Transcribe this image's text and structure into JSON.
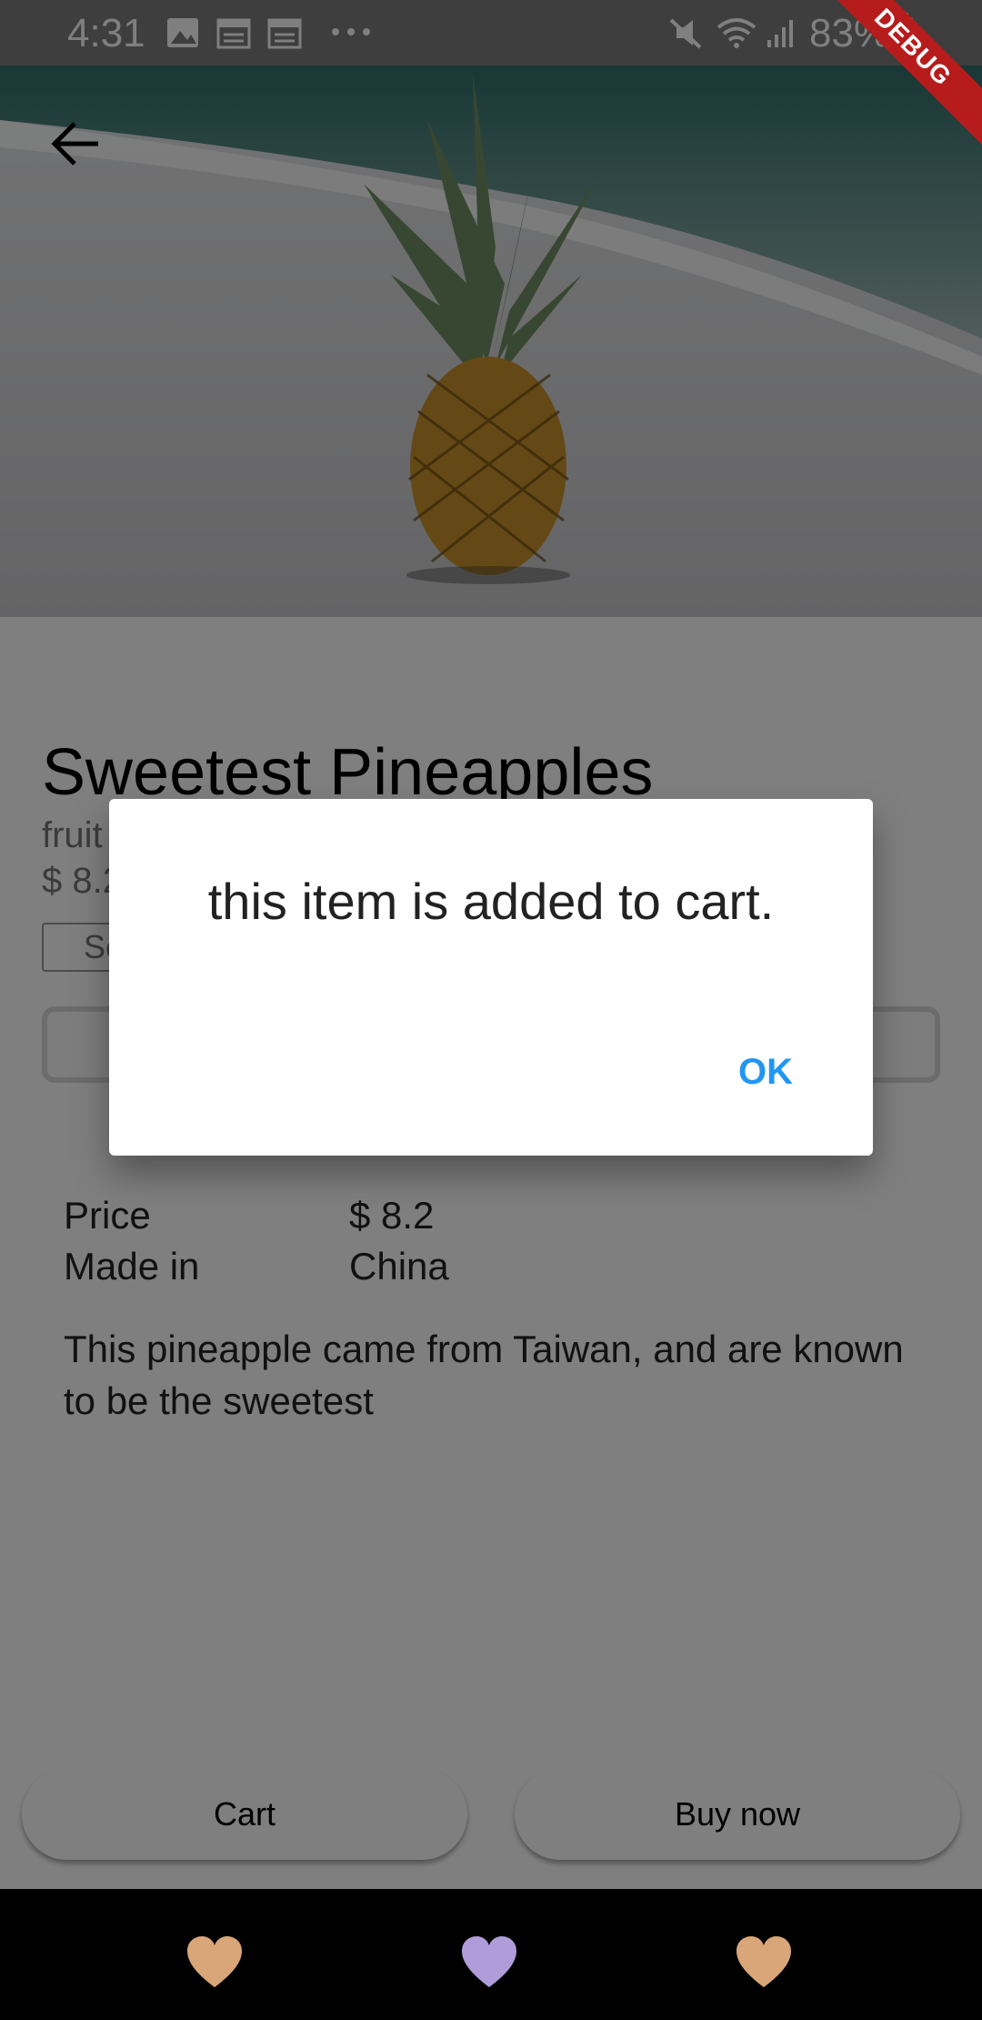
{
  "status_bar": {
    "time": "4:31",
    "battery": "83%",
    "icons": [
      "image-icon",
      "calendar-icon",
      "calendar-icon",
      "more-dots-icon",
      "mute-icon",
      "wifi-icon",
      "signal-icon",
      "battery-icon"
    ]
  },
  "debug_banner": "DEBUG",
  "product": {
    "title": "Sweetest Pineapples",
    "category": "fruit",
    "price_short": "$ 8.2",
    "select_label": "Se",
    "specs": [
      {
        "label": "Price",
        "value": "$ 8.2"
      },
      {
        "label": "Made in",
        "value": "China"
      }
    ],
    "description": "This pineapple came from Taiwan, and are known to be the sweetest"
  },
  "actions": {
    "cart_label": "Cart",
    "buy_label": "Buy now"
  },
  "dialog": {
    "message": "this item is added to cart.",
    "ok_label": "OK"
  },
  "nav": {
    "heart_colors": [
      "#d9a679",
      "#b09cd9",
      "#d9a679"
    ]
  }
}
